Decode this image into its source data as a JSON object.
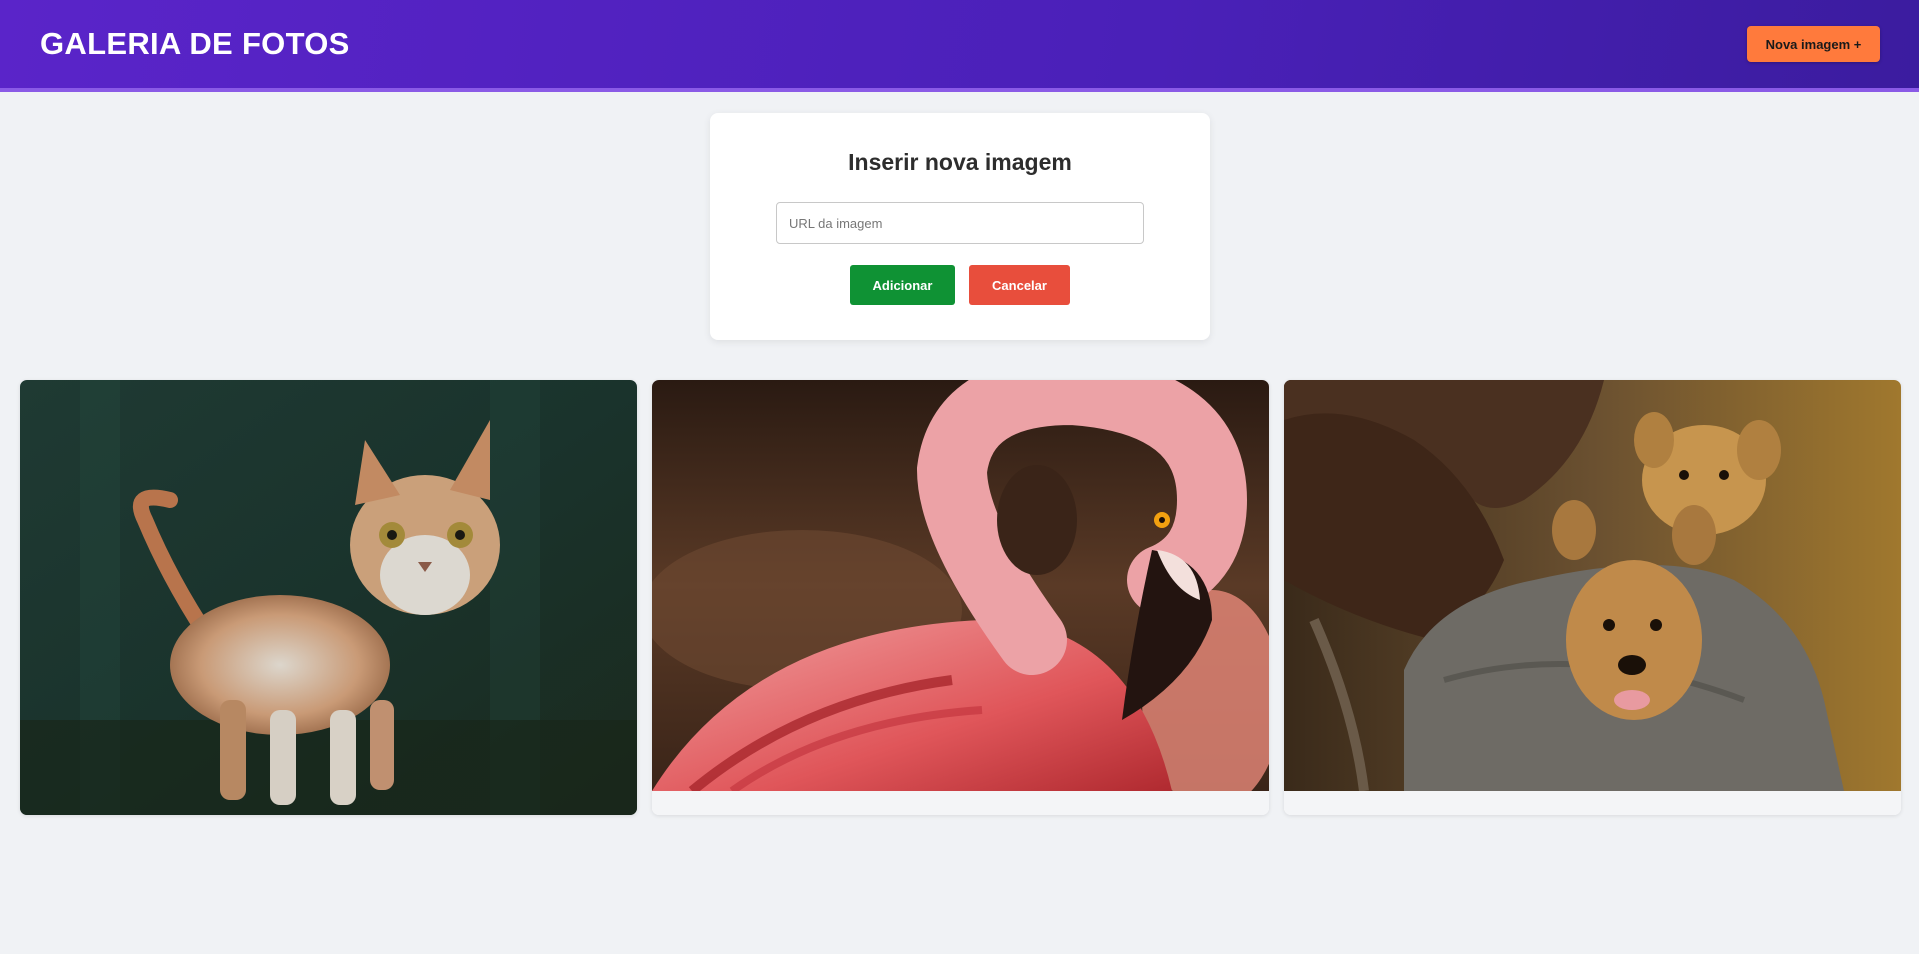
{
  "header": {
    "title": "GALERIA DE FOTOS",
    "new_image_label": "Nova imagem +"
  },
  "form": {
    "title": "Inserir nova imagem",
    "url_placeholder": "URL da imagem",
    "url_value": "",
    "add_label": "Adicionar",
    "cancel_label": "Cancelar"
  },
  "gallery": {
    "images": [
      {
        "subject": "cat painting"
      },
      {
        "subject": "pink flamingo"
      },
      {
        "subject": "puppies in a sack"
      }
    ]
  },
  "colors": {
    "header_start": "#5a24c9",
    "header_end": "#3b1c9f",
    "accent_orange": "#ff7a3c",
    "add_green": "#0f9234",
    "cancel_red": "#e84e3c",
    "page_bg": "#f0f2f5"
  }
}
